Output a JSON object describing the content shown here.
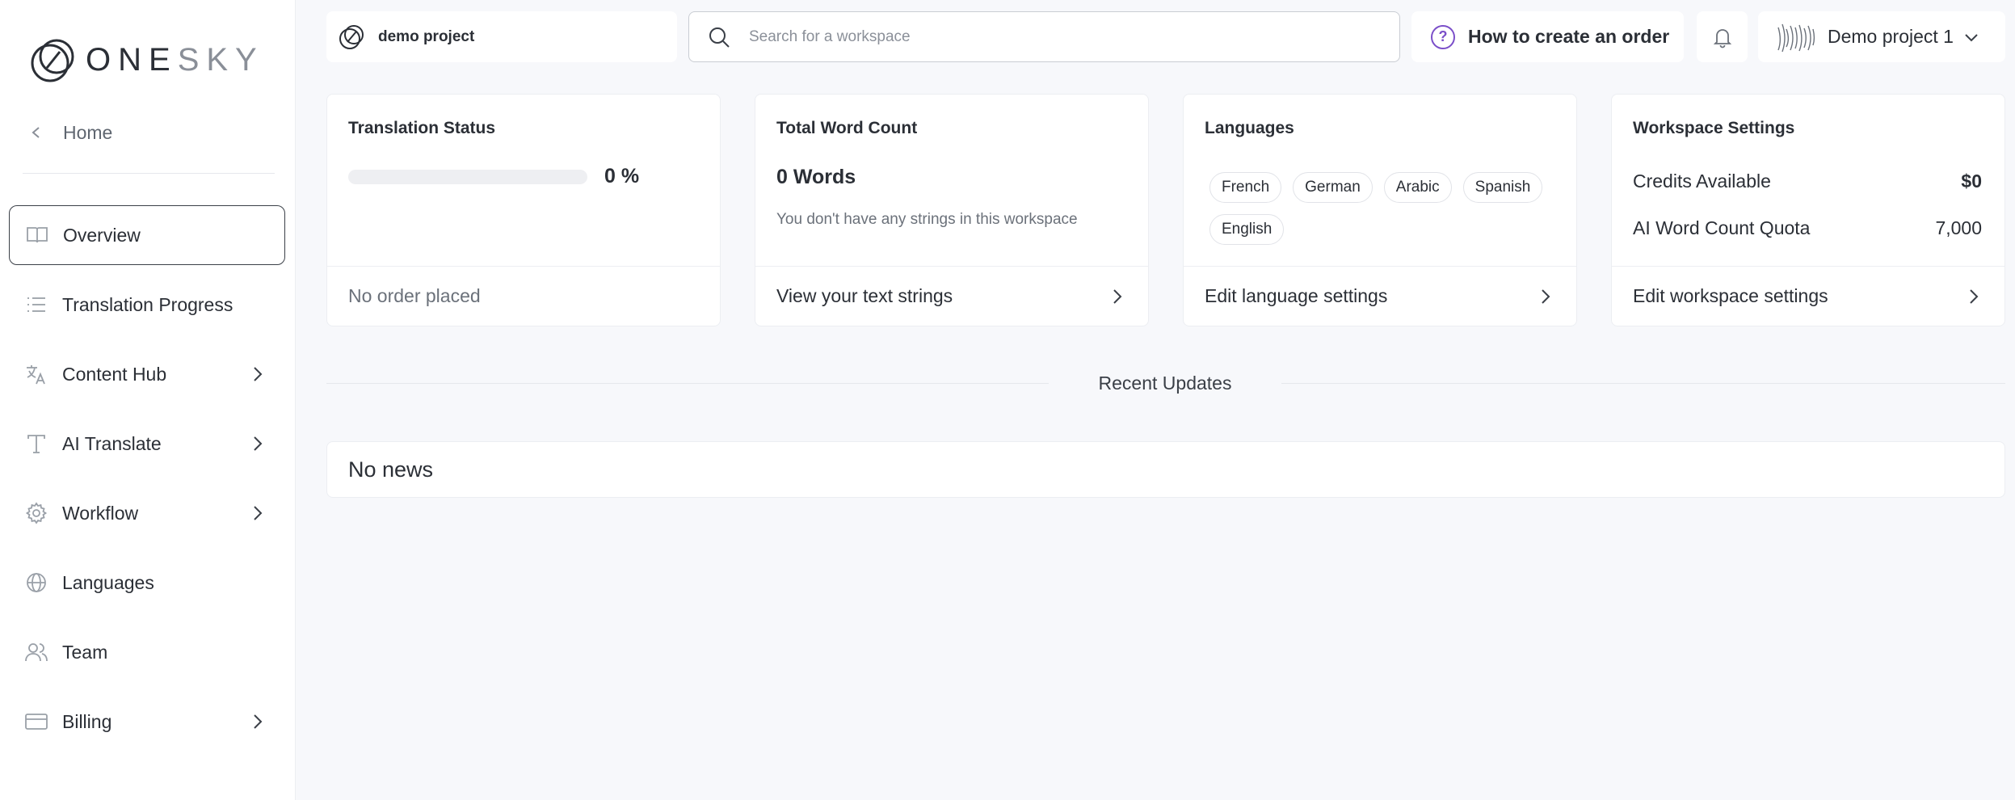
{
  "brand": {
    "name": "ONESKY",
    "name_dark": "ONE",
    "name_light": "SKY"
  },
  "sidebar": {
    "home_label": "Home",
    "items": [
      {
        "label": "Overview",
        "icon": "book-icon",
        "active": true,
        "has_submenu": false
      },
      {
        "label": "Translation Progress",
        "icon": "list-icon",
        "active": false,
        "has_submenu": false
      },
      {
        "label": "Content Hub",
        "icon": "translate-icon",
        "active": false,
        "has_submenu": true
      },
      {
        "label": "AI Translate",
        "icon": "text-icon",
        "active": false,
        "has_submenu": true
      },
      {
        "label": "Workflow",
        "icon": "gear-icon",
        "active": false,
        "has_submenu": true
      },
      {
        "label": "Languages",
        "icon": "globe-icon",
        "active": false,
        "has_submenu": false
      },
      {
        "label": "Team",
        "icon": "users-icon",
        "active": false,
        "has_submenu": false
      },
      {
        "label": "Billing",
        "icon": "credit-card-icon",
        "active": false,
        "has_submenu": true
      }
    ]
  },
  "topbar": {
    "project_name": "demo project",
    "search_placeholder": "Search for a workspace",
    "search_value": "",
    "help_label": "How to create an order",
    "account_label": "Demo project 1"
  },
  "cards": {
    "translation_status": {
      "title": "Translation Status",
      "progress": 0,
      "progress_label": "0 %",
      "footer": "No order placed"
    },
    "word_count": {
      "title": "Total Word Count",
      "words": "0 Words",
      "note": "You don't have any strings in this workspace",
      "footer": "View your text strings"
    },
    "languages": {
      "title": "Languages",
      "chips": [
        "French",
        "German",
        "Arabic",
        "Spanish",
        "English"
      ],
      "footer": "Edit language settings"
    },
    "workspace": {
      "title": "Workspace Settings",
      "credits_label": "Credits Available",
      "credits_value": "$0",
      "quota_label": "AI Word Count Quota",
      "quota_value": "7,000",
      "footer": "Edit workspace settings"
    }
  },
  "recent": {
    "title": "Recent Updates",
    "empty": "No news"
  },
  "colors": {
    "accent": "#7b4fc9",
    "background": "#f7f8fb",
    "card": "#ffffff",
    "text": "#2b2f36"
  }
}
